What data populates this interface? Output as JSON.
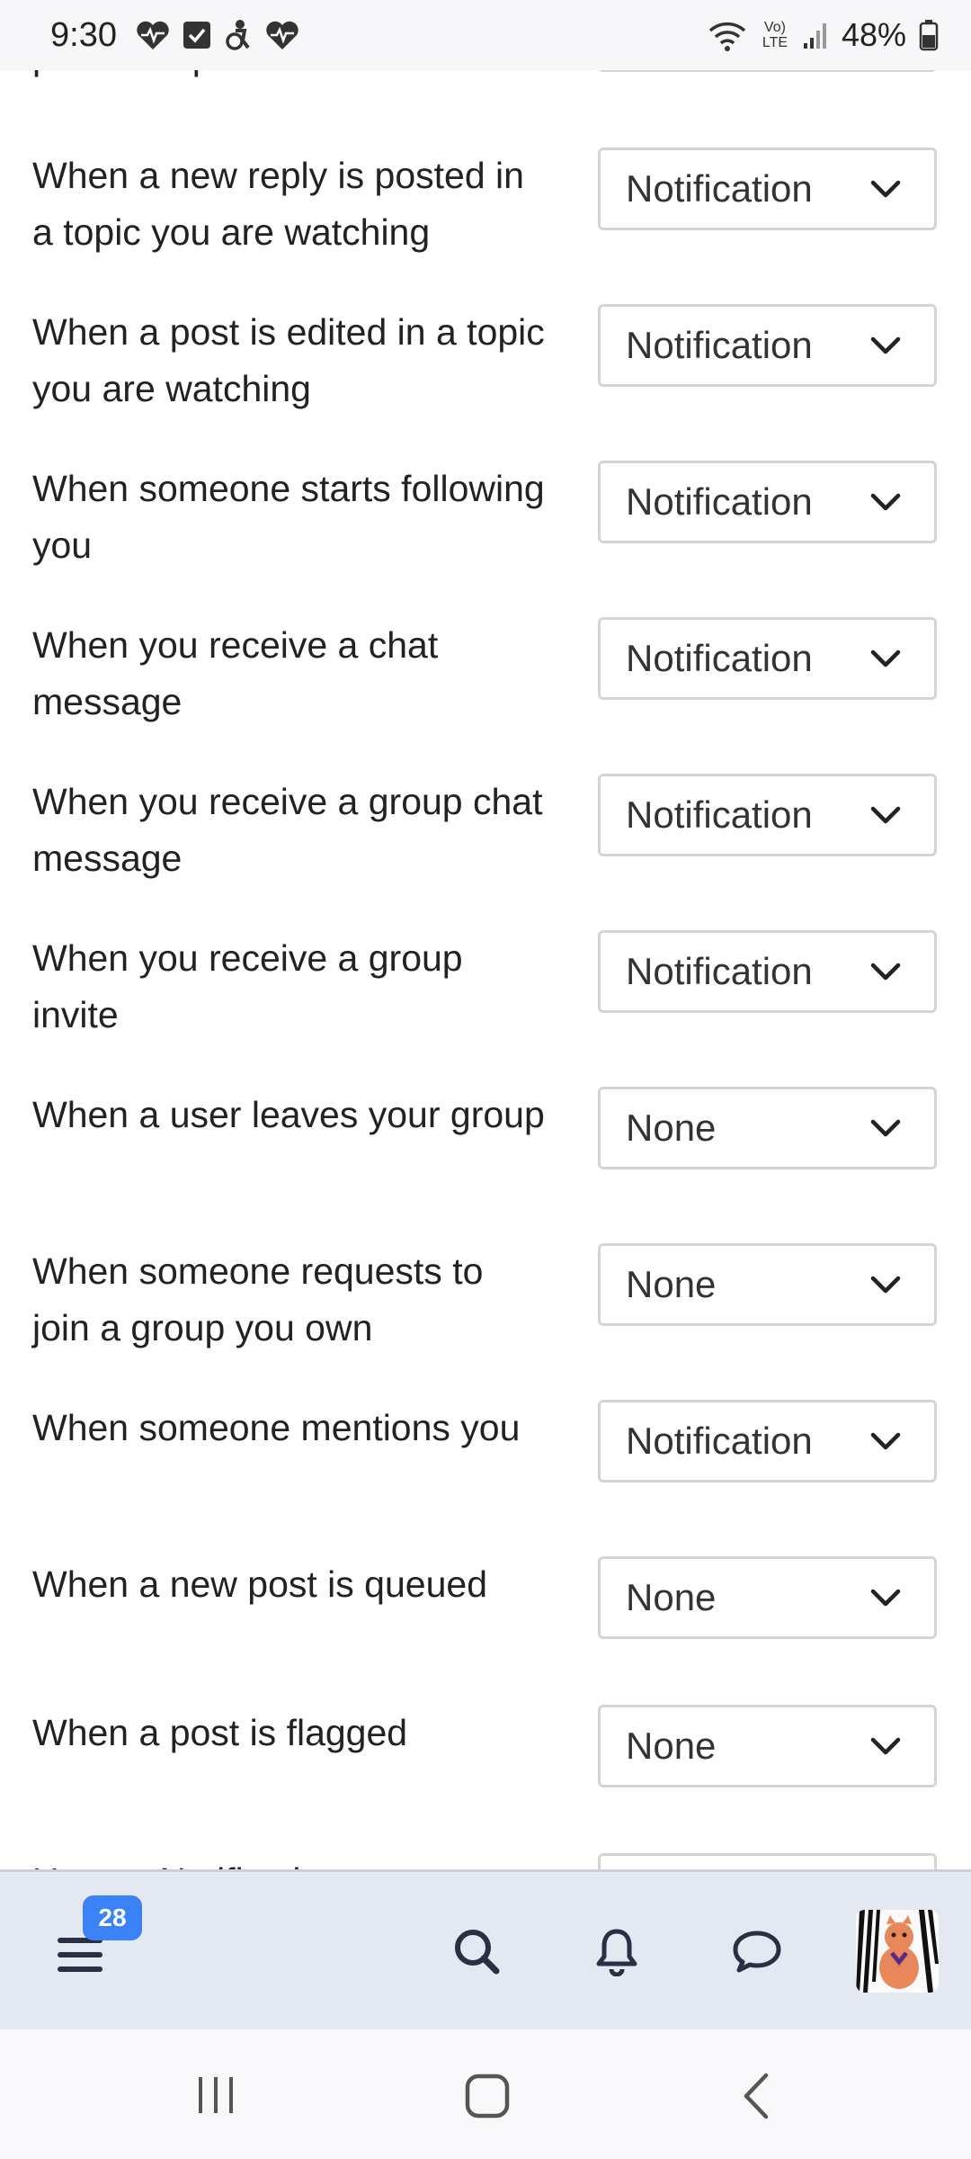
{
  "status_bar": {
    "time": "9:30",
    "battery": "48%",
    "network_label": "Vo) LTE"
  },
  "settings": [
    {
      "label": "posts a topic",
      "value": ""
    },
    {
      "label": "When a new reply is posted in a topic you are watching",
      "value": "Notification"
    },
    {
      "label": "When a post is edited in a topic you are watching",
      "value": "Notification"
    },
    {
      "label": "When someone starts following you",
      "value": "Notification"
    },
    {
      "label": "When you receive a chat message",
      "value": "Notification"
    },
    {
      "label": "When you receive a group chat message",
      "value": "Notification"
    },
    {
      "label": "When you receive a group invite",
      "value": "Notification"
    },
    {
      "label": "When a user leaves your group",
      "value": "None"
    },
    {
      "label": "When someone requests to join a group you own",
      "value": "None"
    },
    {
      "label": "When someone mentions you",
      "value": "Notification"
    },
    {
      "label": "When a new post is queued",
      "value": "None"
    },
    {
      "label": "When a post is flagged",
      "value": "None"
    },
    {
      "label": "Upvote Notifications",
      "value": ""
    }
  ],
  "bottom_nav": {
    "unread_badge": "28",
    "icons": [
      "menu-icon",
      "search-icon",
      "bell-icon",
      "chat-icon",
      "avatar"
    ]
  },
  "colors": {
    "badge": "#3b82f6",
    "nav_background": "#e4e9f1",
    "select_border": "#d4d4d4"
  }
}
